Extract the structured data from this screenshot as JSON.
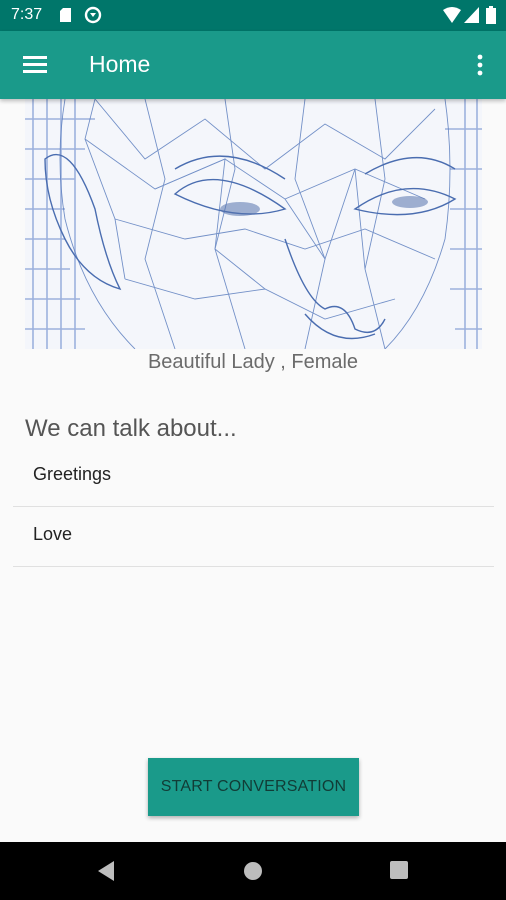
{
  "status_bar": {
    "time": "7:37",
    "icons": [
      "sd-card-icon",
      "sync-icon",
      "wifi-icon",
      "signal-icon",
      "battery-icon"
    ],
    "background": "#00766a"
  },
  "app_bar": {
    "title": "Home",
    "menu_icon": "hamburger-menu-icon",
    "overflow_icon": "more-vert-icon",
    "background": "#1a9a8a"
  },
  "hero": {
    "image": "wireframe-face-image",
    "caption": "Beautiful Lady , Female"
  },
  "topics": {
    "heading": "We can talk about...",
    "items": [
      {
        "label": "Greetings"
      },
      {
        "label": "Love"
      }
    ]
  },
  "actions": {
    "start_label": "START CONVERSATION"
  },
  "nav_bar": {
    "icons": [
      "back-icon",
      "home-icon",
      "recents-icon"
    ]
  }
}
